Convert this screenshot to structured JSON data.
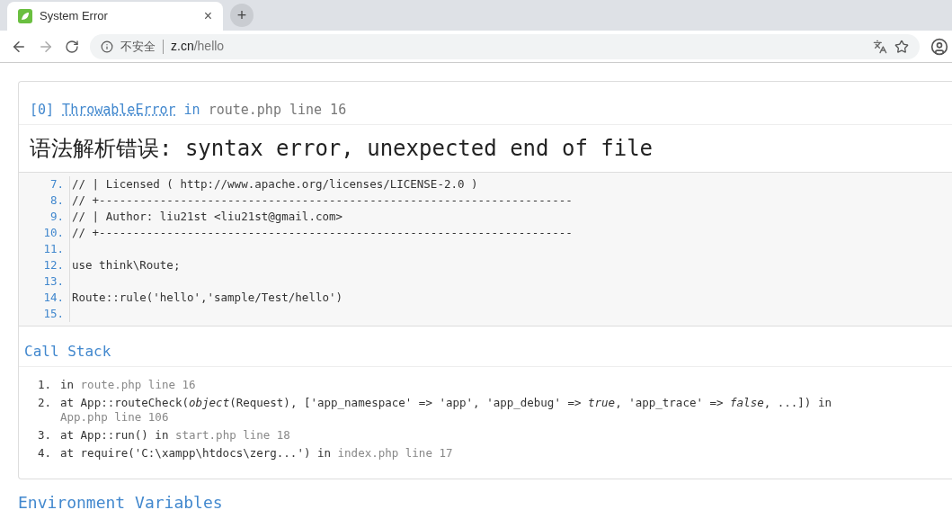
{
  "browser": {
    "tab": {
      "title": "System Error",
      "close": "×",
      "selected": true
    },
    "new_tab": "+",
    "security_label": "不安全",
    "url_host": "z.cn",
    "url_path": "/hello"
  },
  "error": {
    "index": "[0]",
    "class": "ThrowableError",
    "in": "in",
    "location": "route.php line 16",
    "message": "语法解析错误: syntax error, unexpected end of file"
  },
  "source": [
    {
      "number": "7.",
      "code": "// | Licensed ( http://www.apache.org/licenses/LICENSE-2.0 )"
    },
    {
      "number": "8.",
      "code": "// +----------------------------------------------------------------------"
    },
    {
      "number": "9.",
      "code": "// | Author: liu21st <liu21st@gmail.com>"
    },
    {
      "number": "10.",
      "code": "// +----------------------------------------------------------------------"
    },
    {
      "number": "11."
    },
    {
      "number": "12.",
      "code": "use think\\Route;"
    },
    {
      "number": "13."
    },
    {
      "number": "14.",
      "code": "Route::rule('hello','sample/Test/hello')"
    },
    {
      "number": "15."
    }
  ],
  "call_stack": {
    "title": "Call Stack",
    "items": [
      {
        "number": "1.",
        "call": "in",
        "location": "route.php line 16"
      },
      {
        "number": "2.",
        "call": "at App::routeCheck(*object*(Request), ['app_namespace' => 'app', 'app_debug' => *true*, 'app_trace' => *false*, ...]) in",
        "location": "App.php line 106"
      },
      {
        "number": "3.",
        "call": "at App::run() in",
        "location": "start.php line 18"
      },
      {
        "number": "4.",
        "call": "at require('C:\\xampp\\htdocs\\zerg...') in",
        "location": "index.php line 17"
      }
    ]
  },
  "next_section": "Environment Variables"
}
